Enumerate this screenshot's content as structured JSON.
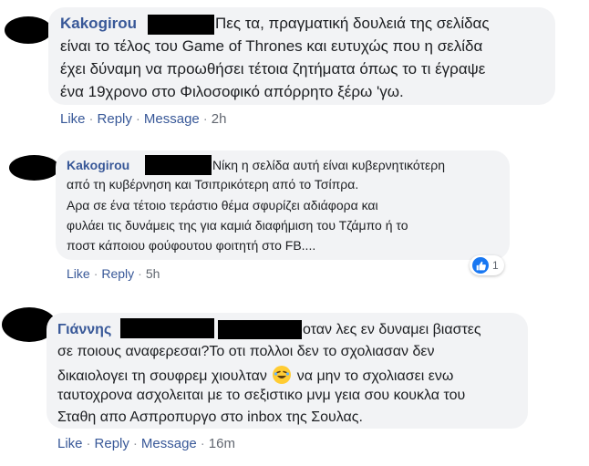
{
  "comments": [
    {
      "author": "Kakogirou",
      "lines": [
        "Πες τα, πραγματική δουλειά της σελίδας",
        "είναι το τέλος του Game of Thrones και ευτυχώς που η σελίδα",
        "έχει δύναμη να προωθήσει τέτοια ζητήματα όπως το τι έγραψε",
        "ένα 19χρονο στο Φιλοσοφικό απόρρητο ξέρω 'γω."
      ],
      "actions": {
        "like": "Like",
        "reply": "Reply",
        "message": "Message",
        "time": "2h"
      }
    },
    {
      "author": "Kakogirou",
      "lines": [
        "Νίκη η σελίδα αυτή είναι κυβερνητικότερη",
        "από τη κυβέρνηση και Τσιπρικότερη από το Τσίπρα.",
        "Αρα σε ένα τέτοιο τεράστιο θέμα σφυρίζει αδιάφορα και",
        "φυλάει τις δυνάμεις της για καμιά διαφήμιση του Τζάμπο ή το",
        "ποστ κάποιου φούφουτου φοιτητή στο FB...."
      ],
      "reactions": {
        "count": "1",
        "icon": "thumbs-up-icon"
      },
      "actions": {
        "like": "Like",
        "reply": "Reply",
        "time": "5h"
      }
    },
    {
      "author": "Γιάννης",
      "lines": [
        "οταν λες εν δυναμει βιαστες",
        "σε ποιους αναφερεσαι?Το οτι πολλοι δεν το σχολιασαν δεν",
        "δικαιολογει τη σουφρεμ χιουλταν",
        "να μην το σχολιασει ενω",
        "ταυτοχρονα ασχολειται με το σεξιστικο μνμ γεια σου κουκλα του",
        "Σταθη απο Ασπροπυργο στο inbox της Σουλας."
      ],
      "emoji": "rolling-on-floor-laughing-icon",
      "actions": {
        "like": "Like",
        "reply": "Reply",
        "message": "Message",
        "time": "16m"
      }
    }
  ],
  "colors": {
    "name": "#385898",
    "bubble": "#f2f3f5",
    "meta": "#616770",
    "like_blue": "#1877f2"
  }
}
